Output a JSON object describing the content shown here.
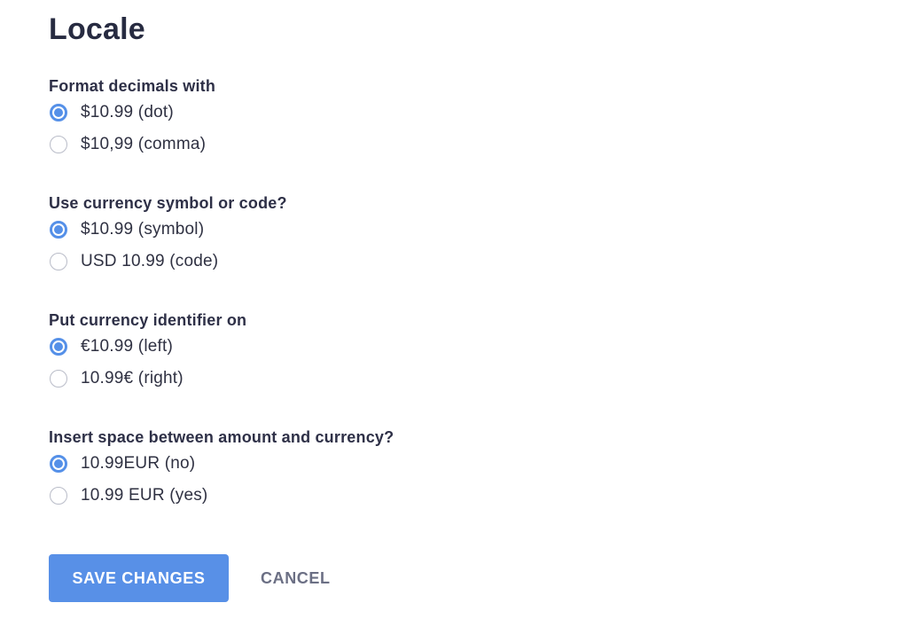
{
  "page": {
    "title": "Locale"
  },
  "groups": [
    {
      "label": "Format decimals with",
      "options": [
        {
          "label": "$10.99 (dot)",
          "checked": true
        },
        {
          "label": "$10,99 (comma)",
          "checked": false
        }
      ]
    },
    {
      "label": "Use currency symbol or code?",
      "options": [
        {
          "label": "$10.99 (symbol)",
          "checked": true
        },
        {
          "label": "USD 10.99 (code)",
          "checked": false
        }
      ]
    },
    {
      "label": "Put currency identifier on",
      "options": [
        {
          "label": "€10.99 (left)",
          "checked": true
        },
        {
          "label": "10.99€ (right)",
          "checked": false
        }
      ]
    },
    {
      "label": "Insert space between amount and currency?",
      "options": [
        {
          "label": "10.99EUR (no)",
          "checked": true
        },
        {
          "label": "10.99 EUR (yes)",
          "checked": false
        }
      ]
    }
  ],
  "actions": {
    "save_label": "SAVE CHANGES",
    "cancel_label": "CANCEL"
  },
  "colors": {
    "accent": "#5890e7",
    "heading": "#272b41",
    "muted": "#6b6f84"
  }
}
